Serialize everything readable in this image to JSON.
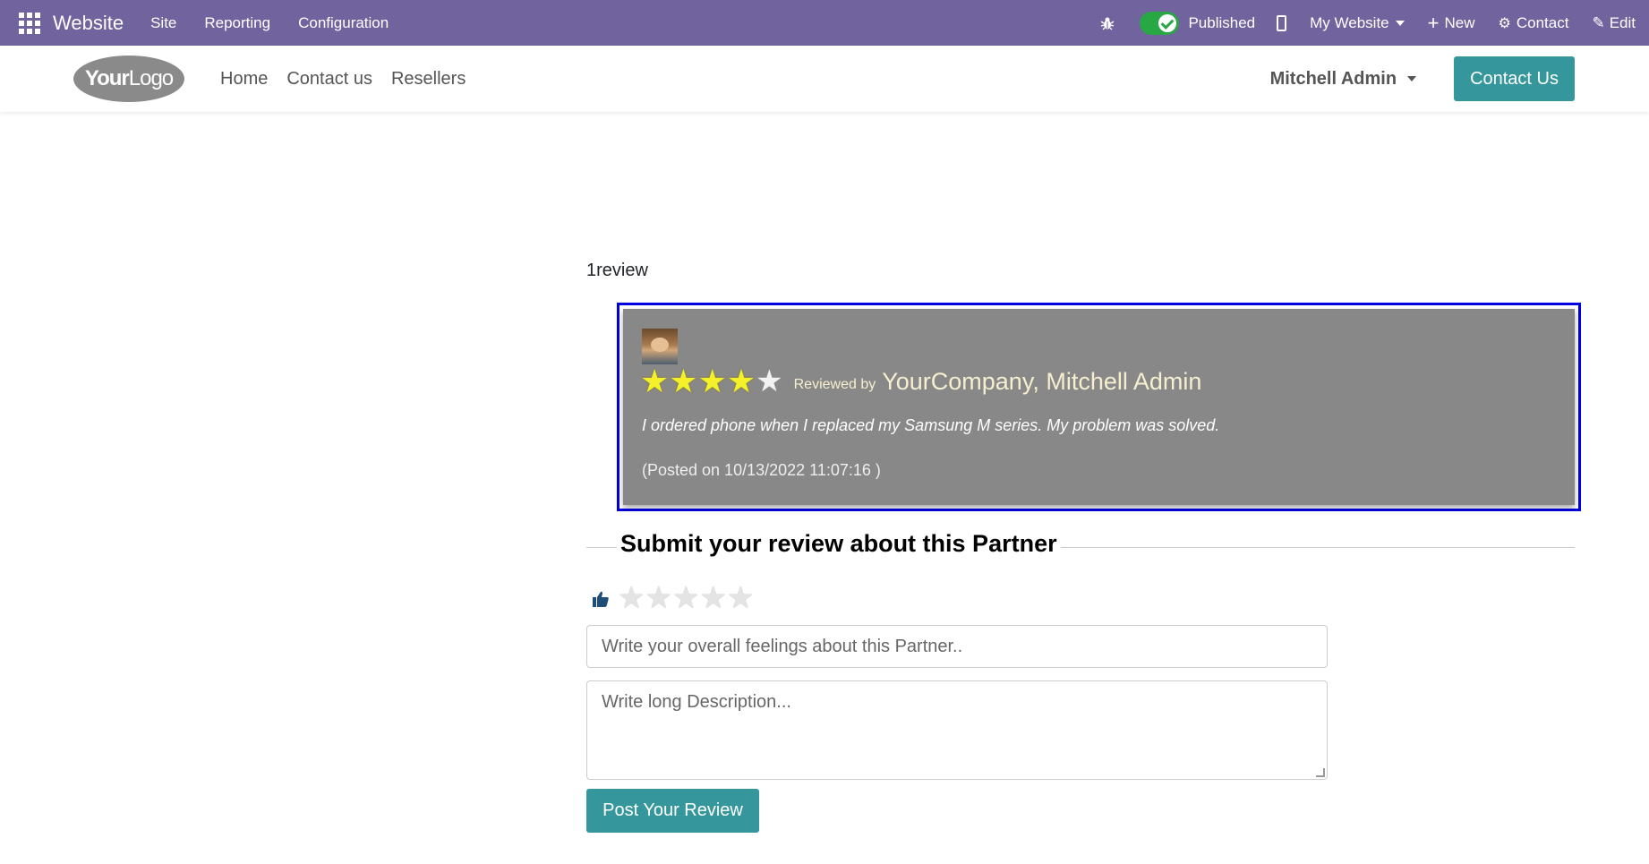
{
  "topbar": {
    "app_name": "Website",
    "menus": [
      "Site",
      "Reporting",
      "Configuration"
    ],
    "published_label": "Published",
    "website_selector": "My Website",
    "new_label": "New",
    "contact_label": "Contact",
    "edit_label": "Edit"
  },
  "header": {
    "logo_bold": "Your",
    "logo_light": "Logo",
    "nav": [
      "Home",
      "Contact us",
      "Resellers"
    ],
    "user": "Mitchell Admin",
    "cta": "Contact Us"
  },
  "reviews": {
    "count_label": "1review",
    "items": [
      {
        "rating": 4,
        "max_rating": 5,
        "reviewed_by_label": "Reviewed by",
        "reviewer": "YourCompany, Mitchell Admin",
        "text": "I ordered phone when I replaced my Samsung M series. My problem was solved.",
        "posted": "(Posted on 10/13/2022 11:07:16 )"
      }
    ]
  },
  "form": {
    "title": "Submit your review about this Partner",
    "rating_selected": 0,
    "summary_placeholder": "Write your overall feelings about this Partner..",
    "description_placeholder": "Write long Description...",
    "submit_label": "Post Your Review"
  },
  "colors": {
    "topbar": "#71639e",
    "accent": "#35979c",
    "highlight_border": "#0000e0",
    "star_on": "#f4f12a"
  }
}
